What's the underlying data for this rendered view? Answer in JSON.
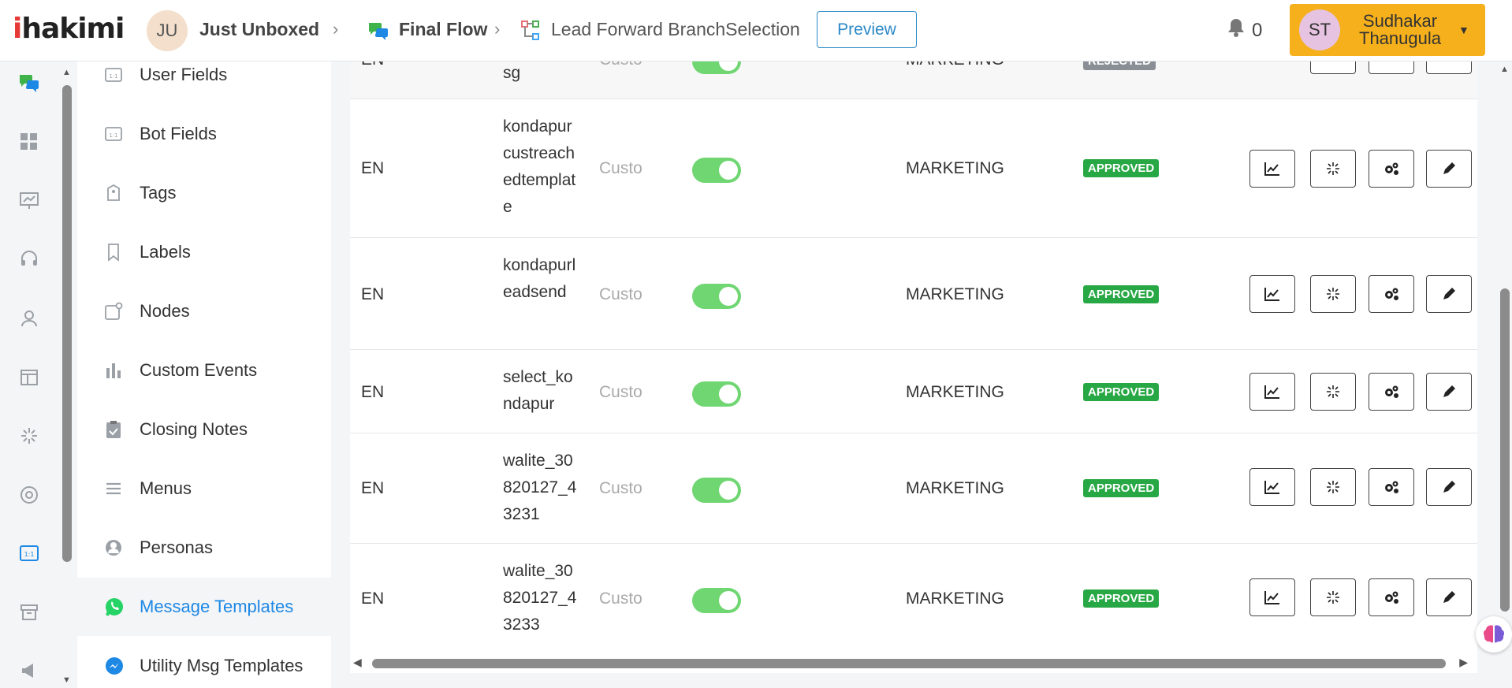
{
  "header": {
    "logo": {
      "i": "i",
      "rest": "hakimi"
    },
    "workspace": {
      "initials": "JU",
      "name": "Just Unboxed"
    },
    "flow": "Final Flow",
    "node": "Lead Forward BranchSelection",
    "preview_label": "Preview",
    "notifications_count": "0",
    "user": {
      "initials": "ST",
      "name_line1": "Sudhakar",
      "name_line2": "Thanugula"
    }
  },
  "rail_icons": [
    "chat-bubbles-icon",
    "dashboard-icon",
    "presentation-icon",
    "headset-icon",
    "user-icon",
    "layout-icon",
    "sparkle-icon",
    "lifebuoy-icon",
    "fields-icon",
    "archive-icon",
    "megaphone-icon"
  ],
  "sidebar": {
    "items": [
      {
        "label": "User Fields",
        "icon": "fields-icon"
      },
      {
        "label": "Bot Fields",
        "icon": "fields-icon"
      },
      {
        "label": "Tags",
        "icon": "tag-icon"
      },
      {
        "label": "Labels",
        "icon": "bookmark-icon"
      },
      {
        "label": "Nodes",
        "icon": "node-icon"
      },
      {
        "label": "Custom Events",
        "icon": "bar-chart-icon"
      },
      {
        "label": "Closing Notes",
        "icon": "clipboard-check-icon"
      },
      {
        "label": "Menus",
        "icon": "menu-icon"
      },
      {
        "label": "Personas",
        "icon": "person-circle-icon"
      },
      {
        "label": "Message Templates",
        "icon": "whatsapp-icon",
        "active": true
      },
      {
        "label": "Utility Msg Templates",
        "icon": "messenger-icon"
      }
    ]
  },
  "table": {
    "rows": [
      {
        "lang": "EN",
        "name": "sg",
        "category": "Custo",
        "type": "MARKETING",
        "status": "REJECTED",
        "partial": true
      },
      {
        "lang": "EN",
        "name": "kondapurcustreachedtemplate",
        "category": "Custo",
        "type": "MARKETING",
        "status": "APPROVED"
      },
      {
        "lang": "EN",
        "name": "kondapurleadsend",
        "category": "Custo",
        "type": "MARKETING",
        "status": "APPROVED"
      },
      {
        "lang": "EN",
        "name": "select_kondapur",
        "category": "Custo",
        "type": "MARKETING",
        "status": "APPROVED"
      },
      {
        "lang": "EN",
        "name": "walite_30820127_43231",
        "category": "Custo",
        "type": "MARKETING",
        "status": "APPROVED"
      },
      {
        "lang": "EN",
        "name": "walite_30820127_43233",
        "category": "Custo",
        "type": "MARKETING",
        "status": "APPROVED"
      }
    ],
    "actions": [
      "analytics-icon",
      "sparkle-icon",
      "gears-icon",
      "pencil-icon"
    ]
  }
}
